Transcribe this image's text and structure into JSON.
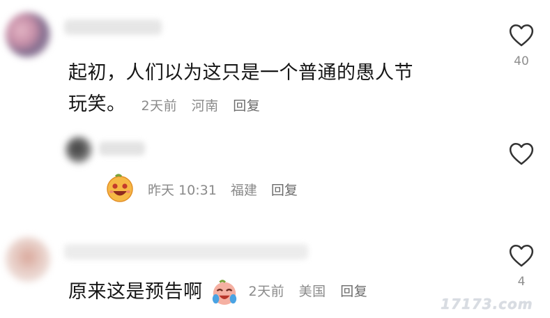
{
  "comments": [
    {
      "text_line1": "起初，人们以为这只是一个普通的愚人节",
      "text_line2": "玩笑。",
      "time": "2天前",
      "location": "河南",
      "reply_label": "回复",
      "like_count": "40"
    },
    {
      "time": "昨天 10:31",
      "location": "福建",
      "reply_label": "回复",
      "like_count": ""
    },
    {
      "text": "原来这是预告啊",
      "time": "2天前",
      "location": "美国",
      "reply_label": "回复",
      "like_count": "4"
    }
  ],
  "icons": {
    "like": "heart-outline-icon",
    "emoji_reply": "laughing-face-emoji",
    "emoji_inline": "crying-laughing-face-emoji"
  },
  "watermark": "17173.com",
  "colors": {
    "text": "#161616",
    "meta": "#8a8a8a",
    "heart_stroke": "#333333"
  }
}
